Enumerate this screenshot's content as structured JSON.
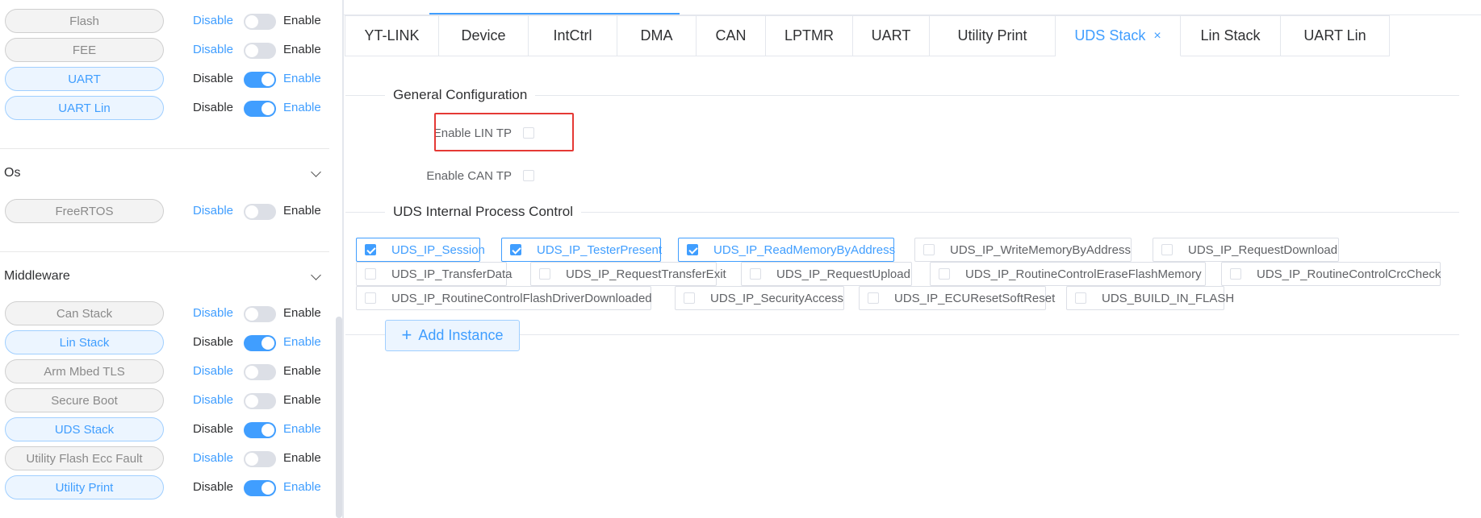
{
  "sidebar": {
    "toggle_labels": {
      "disable": "Disable",
      "enable": "Enable"
    },
    "modules_top": [
      {
        "name": "Flash",
        "enabled": false
      },
      {
        "name": "FEE",
        "enabled": false
      },
      {
        "name": "UART",
        "enabled": true
      },
      {
        "name": "UART Lin",
        "enabled": true
      }
    ],
    "sections": [
      {
        "title": "Os",
        "modules": [
          {
            "name": "FreeRTOS",
            "enabled": false
          }
        ]
      },
      {
        "title": "Middleware",
        "modules": [
          {
            "name": "Can Stack",
            "enabled": false
          },
          {
            "name": "Lin Stack",
            "enabled": true
          },
          {
            "name": "Arm Mbed TLS",
            "enabled": false
          },
          {
            "name": "Secure Boot",
            "enabled": false
          },
          {
            "name": "UDS Stack",
            "enabled": true
          },
          {
            "name": "Utility Flash Ecc Fault",
            "enabled": false
          },
          {
            "name": "Utility Print",
            "enabled": true
          }
        ]
      }
    ]
  },
  "tabs": [
    {
      "label": "YT-LINK",
      "active": false
    },
    {
      "label": "Device",
      "active": false
    },
    {
      "label": "IntCtrl",
      "active": false
    },
    {
      "label": "DMA",
      "active": false
    },
    {
      "label": "CAN",
      "active": false
    },
    {
      "label": "LPTMR",
      "active": false
    },
    {
      "label": "UART",
      "active": false
    },
    {
      "label": "Utility Print",
      "active": false
    },
    {
      "label": "UDS Stack",
      "active": true,
      "close_icon": "×"
    },
    {
      "label": "Lin Stack",
      "active": false
    },
    {
      "label": "UART Lin",
      "active": false
    }
  ],
  "general_config": {
    "legend": "General Configuration",
    "fields": [
      {
        "label": "Enable LIN TP",
        "checked": false
      },
      {
        "label": "Enable CAN TP",
        "checked": false
      }
    ]
  },
  "uds_process": {
    "legend": "UDS Internal Process Control",
    "items": [
      {
        "label": "UDS_IP_Session",
        "checked": true
      },
      {
        "label": "UDS_IP_TesterPresent",
        "checked": true
      },
      {
        "label": "UDS_IP_ReadMemoryByAddress",
        "checked": true
      },
      {
        "label": "UDS_IP_WriteMemoryByAddress",
        "checked": false
      },
      {
        "label": "UDS_IP_RequestDownload",
        "checked": false
      },
      {
        "label": "UDS_IP_TransferData",
        "checked": false
      },
      {
        "label": "UDS_IP_RequestTransferExit",
        "checked": false
      },
      {
        "label": "UDS_IP_RequestUpload",
        "checked": false
      },
      {
        "label": "UDS_IP_RoutineControlEraseFlashMemory",
        "checked": false
      },
      {
        "label": "UDS_IP_RoutineControlCrcCheck",
        "checked": false
      },
      {
        "label": "UDS_IP_RoutineControlFlashDriverDownloaded",
        "checked": false
      },
      {
        "label": "UDS_IP_SecurityAccess",
        "checked": false
      },
      {
        "label": "UDS_IP_ECUResetSoftReset",
        "checked": false
      },
      {
        "label": "UDS_BUILD_IN_FLASH",
        "checked": false
      }
    ]
  },
  "add_instance": {
    "icon": "+",
    "label": "Add Instance"
  },
  "colors": {
    "accent": "#409eff",
    "highlight": "#e53935"
  }
}
